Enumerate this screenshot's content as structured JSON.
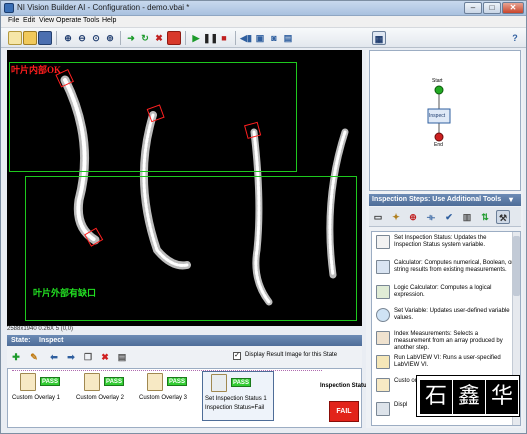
{
  "window": {
    "title": "NI Vision Builder AI - Configuration - demo.vbai *"
  },
  "menu": [
    "File",
    "Edit",
    "View",
    "Operate",
    "Tools",
    "Help"
  ],
  "image": {
    "label_inner": "叶片内部OK",
    "label_outer": "叶片外部有缺口",
    "status": "2588x1940 0.26X 5   (0,0)"
  },
  "state": {
    "header_label": "State:",
    "header_value": "Inspect",
    "display_result_label": "Display Result Image for this State",
    "display_result_checked": true
  },
  "steps": [
    {
      "label": "Custom Overlay 1",
      "result": "PASS"
    },
    {
      "label": "Custom Overlay 2",
      "result": "PASS"
    },
    {
      "label": "Custom Overlay 3",
      "result": "PASS"
    },
    {
      "label": "Set Inspection Status 1",
      "sublabel": "Inspection Status=Fail",
      "result": "PASS"
    }
  ],
  "inspection_status": {
    "label": "Inspection Status",
    "value": "FAIL"
  },
  "flow": {
    "start": "Start",
    "node": "Inspect",
    "end": "End"
  },
  "tools_panel": {
    "title": "Inspection Steps: Use Additional Tools",
    "items": [
      {
        "name": "Set Inspection Status:",
        "desc": "Updates the Inspection Status system variable."
      },
      {
        "name": "Calculator:",
        "desc": "Computes numerical, Boolean, or string results from existing measurements."
      },
      {
        "name": "Logic Calculator:",
        "desc": "Computes a logical expression."
      },
      {
        "name": "Set Variable:",
        "desc": "Updates user-defined variable values."
      },
      {
        "name": "Index Measurements:",
        "desc": "Selects a measurement from an array produced by another step."
      },
      {
        "name": "Run LabVIEW VI:",
        "desc": "Runs a user-specified LabVIEW VI."
      },
      {
        "name": "Custo",
        "desc": "onto t"
      },
      {
        "name": "Displ",
        "desc": ""
      }
    ]
  },
  "watermark": [
    "石",
    "鑫",
    "华"
  ],
  "colors": {
    "pass": "#33cc33",
    "fail": "#e2231a",
    "roi": "#1ec81e",
    "header": "#5a79a4"
  }
}
